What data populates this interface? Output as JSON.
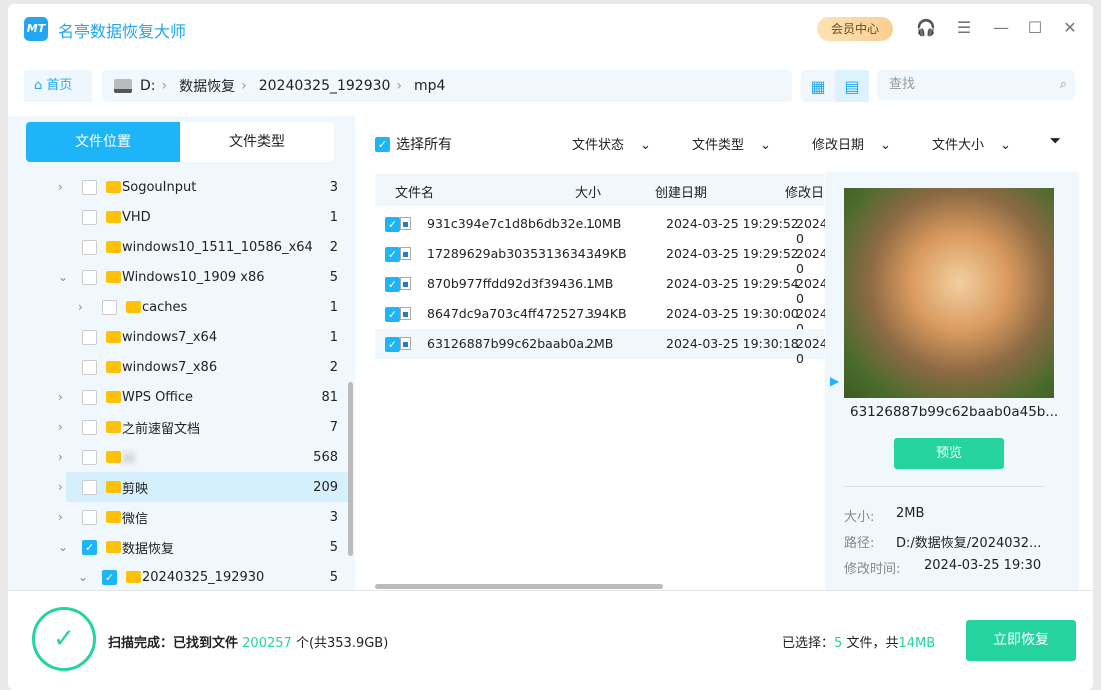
{
  "app": {
    "logo_text": "MT",
    "title": "名亭数据恢复大师",
    "vip_label": "会员中心"
  },
  "nav": {
    "home": "首页",
    "crumbs": [
      "D:",
      "数据恢复",
      "20240325_192930",
      "mp4"
    ],
    "search_placeholder": "查找"
  },
  "sidebar": {
    "tabs": [
      "文件位置",
      "文件类型"
    ],
    "active_tab": 0,
    "items": [
      {
        "name": "SogouInput",
        "count": "3",
        "level": 1,
        "chevron": "right",
        "checked": false
      },
      {
        "name": "VHD",
        "count": "1",
        "level": 1,
        "chevron": "",
        "checked": false
      },
      {
        "name": "windows10_1511_10586_x64",
        "count": "2",
        "level": 1,
        "chevron": "",
        "checked": false
      },
      {
        "name": "Windows10_1909 x86",
        "count": "5",
        "level": 1,
        "chevron": "down",
        "checked": false
      },
      {
        "name": "caches",
        "count": "1",
        "level": 2,
        "chevron": "right",
        "checked": false
      },
      {
        "name": "windows7_x64",
        "count": "1",
        "level": 1,
        "chevron": "",
        "checked": false
      },
      {
        "name": "windows7_x86",
        "count": "2",
        "level": 1,
        "chevron": "",
        "checked": false
      },
      {
        "name": "WPS Office",
        "count": "81",
        "level": 1,
        "chevron": "right",
        "checked": false
      },
      {
        "name": "之前速留文档",
        "count": "7",
        "level": 1,
        "chevron": "right",
        "checked": false
      },
      {
        "name": "兴",
        "count": "568",
        "level": 1,
        "chevron": "right",
        "checked": false,
        "blurred": true
      },
      {
        "name": "剪映",
        "count": "209",
        "level": 1,
        "chevron": "right",
        "checked": false,
        "selected": true
      },
      {
        "name": "微信",
        "count": "3",
        "level": 1,
        "chevron": "right",
        "checked": false
      },
      {
        "name": "数据恢复",
        "count": "5",
        "level": 1,
        "chevron": "down",
        "checked": true
      },
      {
        "name": "20240325_192930",
        "count": "5",
        "level": 2,
        "chevron": "down",
        "checked": true
      }
    ]
  },
  "toolbar": {
    "select_all": "选择所有",
    "filters": [
      "文件状态",
      "文件类型",
      "修改日期",
      "文件大小"
    ]
  },
  "table": {
    "columns": [
      "文件名",
      "大小",
      "创建日期",
      "修改日"
    ],
    "rows": [
      {
        "name": "931c394e7c1d8b6db32e...",
        "size": "10MB",
        "created": "2024-03-25 19:29:52",
        "modified": "2024-0"
      },
      {
        "name": "17289629ab3035313634...",
        "size": "349KB",
        "created": "2024-03-25 19:29:52",
        "modified": "2024-0"
      },
      {
        "name": "870b977ffdd92d3f39436...",
        "size": "1MB",
        "created": "2024-03-25 19:29:54",
        "modified": "2024-0"
      },
      {
        "name": "8647dc9a703c4ff472527...",
        "size": "394KB",
        "created": "2024-03-25 19:30:00",
        "modified": "2024-0"
      },
      {
        "name": "63126887b99c62baab0a...",
        "size": "2MB",
        "created": "2024-03-25 19:30:18",
        "modified": "2024-0"
      }
    ]
  },
  "preview": {
    "filename": "63126887b99c62baab0a45b...",
    "button": "预览",
    "size_label": "大小:",
    "size": "2MB",
    "path_label": "路径:",
    "path": "D:/数据恢复/2024032...",
    "mtime_label": "修改时间:",
    "mtime": "2024-03-25 19:30"
  },
  "footer": {
    "status_prefix": "扫描完成：已找到文件",
    "found": "200257",
    "status_suffix": "个(共353.9GB)",
    "sel_prefix": "已选择：",
    "sel_count": "5",
    "sel_mid": "文件，共",
    "sel_size": "14MB",
    "recover": "立即恢复"
  },
  "colors": {
    "accent": "#1eb4f8",
    "green": "#25d3a0"
  }
}
